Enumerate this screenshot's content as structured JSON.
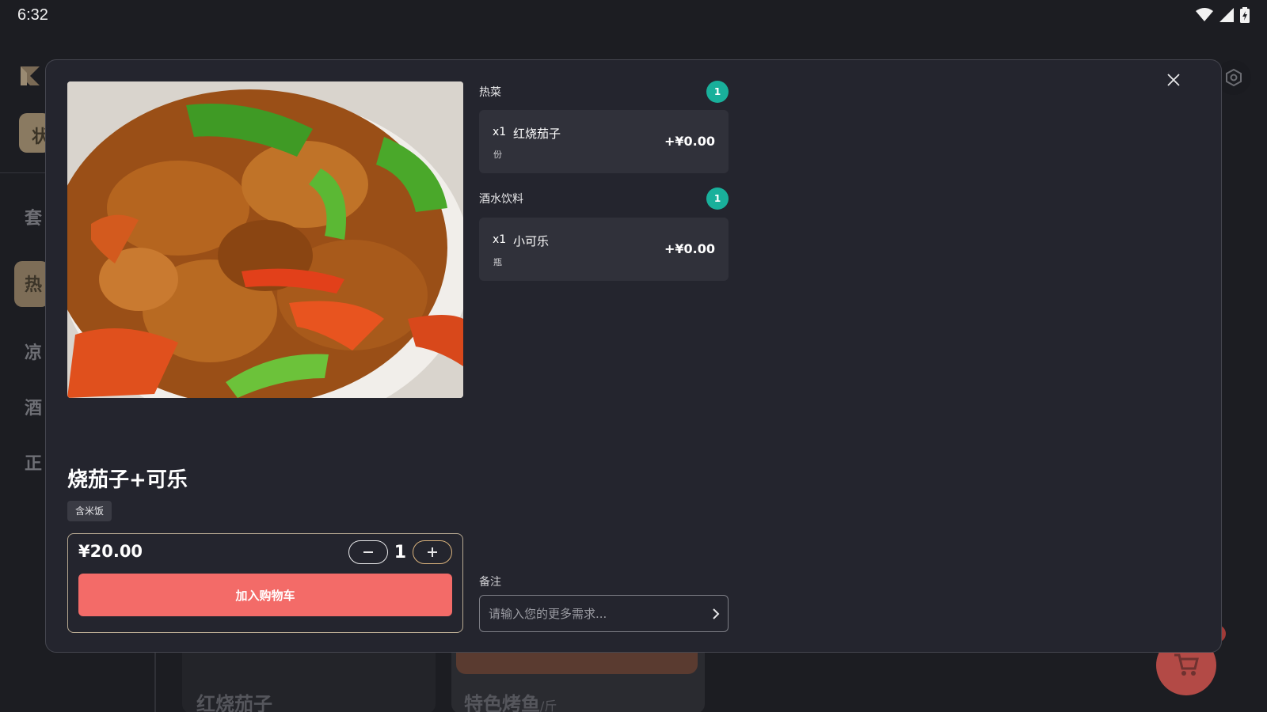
{
  "status_bar": {
    "time": "6:32"
  },
  "background": {
    "chip_label": "状",
    "nav_items": [
      "套",
      "热",
      "凉",
      "酒",
      "正"
    ],
    "cards": [
      {
        "title": "红烧茄子",
        "unit": ""
      },
      {
        "title": "特色烤鱼",
        "unit": "/斤"
      }
    ]
  },
  "modal": {
    "dish_title": "烧茄子+可乐",
    "tag": "含米饭",
    "price": "¥20.00",
    "quantity": "1",
    "add_to_cart_label": "加入购物车",
    "option_groups": [
      {
        "title": "热菜",
        "count": "1",
        "item": {
          "qty": "x1",
          "name": "红烧茄子",
          "unit": "份",
          "price": "+¥0.00"
        }
      },
      {
        "title": "酒水饮料",
        "count": "1",
        "item": {
          "qty": "x1",
          "name": "小可乐",
          "unit": "瓶",
          "price": "+¥0.00"
        }
      }
    ],
    "remark": {
      "label": "备注",
      "placeholder": "请输入您的更多需求..."
    }
  },
  "colors": {
    "accent_red": "#f36b68",
    "badge_teal": "#19b09b",
    "modal_bg": "#24252e"
  },
  "icons": [
    "wifi-icon",
    "signal-icon",
    "battery-icon",
    "close-icon",
    "minus-icon",
    "plus-icon",
    "chevron-right-icon",
    "gear-icon",
    "cart-icon",
    "app-logo"
  ]
}
